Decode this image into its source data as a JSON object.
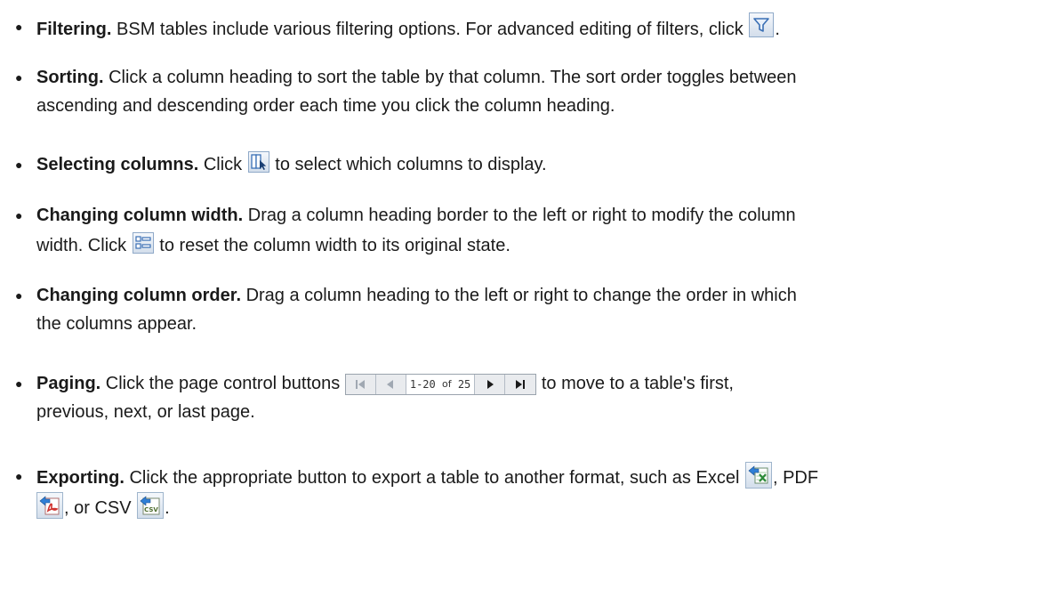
{
  "items": [
    {
      "title": "Filtering.",
      "text_before": " BSM tables include various filtering options. For advanced editing of filters, click ",
      "text_after": "."
    },
    {
      "title": "Sorting.",
      "line1": " Click a column heading to sort the table by that column. The sort order toggles between",
      "line2": "ascending and descending order each time you click the column heading."
    },
    {
      "title": "Selecting columns.",
      "text_before": " Click ",
      "text_after": " to select which columns to display."
    },
    {
      "title": "Changing column width.",
      "line1": " Drag a column heading border to the left or right to modify the column",
      "line2_before": "width. Click ",
      "line2_after": " to reset the column width to its original state."
    },
    {
      "title": "Changing column order.",
      "line1": " Drag a column heading to the left or right to change the order in which",
      "line2": "the columns appear."
    },
    {
      "title": "Paging.",
      "text_before": " Click the page control buttons ",
      "text_after": " to move to a table's first,",
      "line2": "previous, next, or last page.",
      "pager": {
        "range": "1-20",
        "of": "of",
        "total": "25"
      }
    },
    {
      "title": "Exporting.",
      "text_before": " Click the appropriate button to export a table to another format, such as Excel ",
      "text_after": ", PDF",
      "line2_mid": ", or CSV ",
      "line2_after": "."
    }
  ],
  "icons": {
    "filter": "filter-icon",
    "select_columns": "select-columns-icon",
    "reset_width": "reset-column-width-icon",
    "first_page": "first-page-icon",
    "previous_page": "previous-page-icon",
    "next_page": "next-page-icon",
    "last_page": "last-page-icon",
    "excel": "excel-export-icon",
    "pdf": "pdf-export-icon",
    "csv": "csv-export-icon"
  },
  "colors": {
    "text": "#1a1a1a",
    "button_border": "#8fa9c8",
    "button_blue": "#3a6fb5",
    "excel_green": "#2e8b3a",
    "pdf_red": "#d0322e"
  }
}
